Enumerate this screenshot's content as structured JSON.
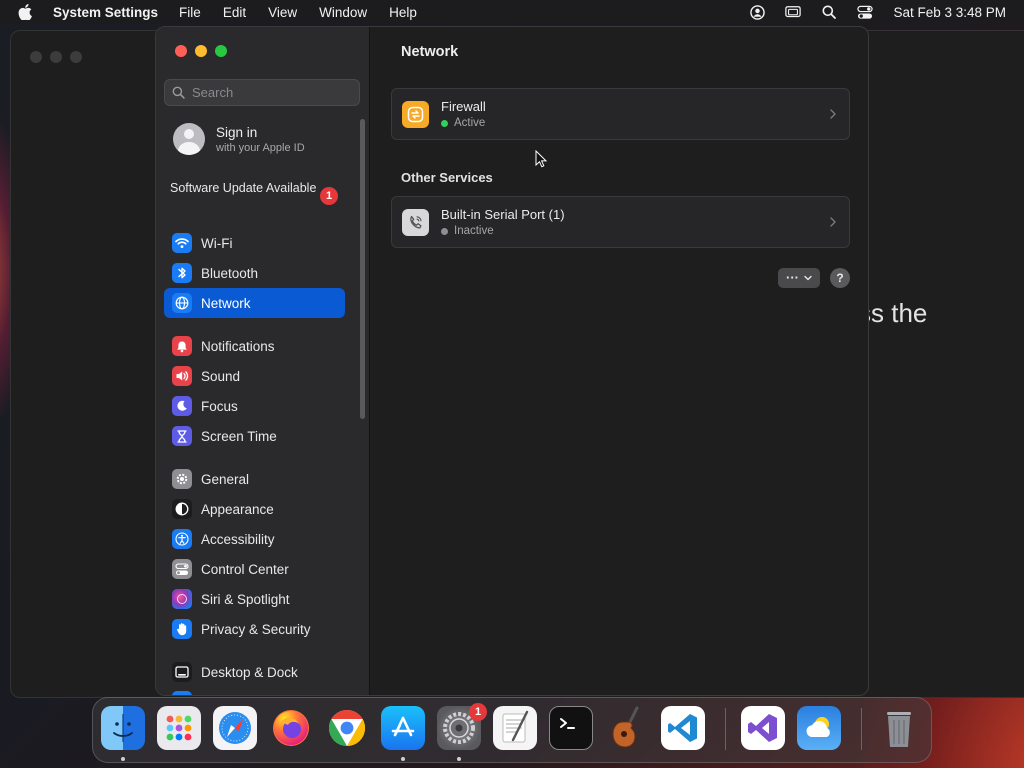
{
  "menubar": {
    "app_name": "System Settings",
    "items": [
      "File",
      "Edit",
      "View",
      "Window",
      "Help"
    ],
    "clock": "Sat Feb 3  3:48 PM"
  },
  "background_window": {
    "visible_text": "ss the"
  },
  "sidebar": {
    "search_placeholder": "Search",
    "sign_in": {
      "title": "Sign in",
      "subtitle": "with your Apple ID"
    },
    "update": {
      "label": "Software Update Available",
      "badge": "1"
    },
    "groups": [
      [
        {
          "label": "Wi-Fi",
          "icon": "wifi-icon",
          "color": "#1a7cf5"
        },
        {
          "label": "Bluetooth",
          "icon": "bluetooth-icon",
          "color": "#1a7cf5"
        },
        {
          "label": "Network",
          "icon": "globe-icon",
          "color": "#1a7cf5",
          "selected": true
        }
      ],
      [
        {
          "label": "Notifications",
          "icon": "bell-icon",
          "color": "#e8424b"
        },
        {
          "label": "Sound",
          "icon": "speaker-icon",
          "color": "#e8424b"
        },
        {
          "label": "Focus",
          "icon": "moon-icon",
          "color": "#5e5ce6"
        },
        {
          "label": "Screen Time",
          "icon": "hourglass-icon",
          "color": "#5e5ce6"
        }
      ],
      [
        {
          "label": "General",
          "icon": "gear-icon",
          "color": "#8e8e93"
        },
        {
          "label": "Appearance",
          "icon": "appearance-icon",
          "color": "#1c1c1e"
        },
        {
          "label": "Accessibility",
          "icon": "accessibility-icon",
          "color": "#1a7cf5"
        },
        {
          "label": "Control Center",
          "icon": "control-center-icon",
          "color": "#8e8e93"
        },
        {
          "label": "Siri & Spotlight",
          "icon": "siri-icon",
          "color": "#8a3ab9"
        },
        {
          "label": "Privacy & Security",
          "icon": "hand-icon",
          "color": "#1a7cf5"
        }
      ],
      [
        {
          "label": "Desktop & Dock",
          "icon": "desktop-icon",
          "color": "#1c1c1e"
        }
      ]
    ]
  },
  "content": {
    "title": "Network",
    "firewall": {
      "title": "Firewall",
      "status": "Active",
      "status_color": "#30d158"
    },
    "other_services_title": "Other Services",
    "serial_port": {
      "title": "Built-in Serial Port (1)",
      "status": "Inactive",
      "status_color": "#8e8e93"
    },
    "more_label": "···",
    "help_label": "?"
  },
  "dock": {
    "apps": [
      {
        "name": "Finder",
        "running": true
      },
      {
        "name": "Launchpad",
        "running": false
      },
      {
        "name": "Safari",
        "running": false
      },
      {
        "name": "Firefox",
        "running": false
      },
      {
        "name": "Chrome",
        "running": false
      },
      {
        "name": "App Store",
        "running": true
      },
      {
        "name": "System Settings",
        "running": true,
        "badge": "1"
      },
      {
        "name": "TextEdit",
        "running": false
      },
      {
        "name": "Terminal",
        "running": false
      },
      {
        "name": "GarageBand",
        "running": false
      },
      {
        "name": "Visual Studio Code",
        "running": false
      },
      {
        "name": "Visual Studio",
        "running": false
      },
      {
        "name": "Weather",
        "running": false
      },
      {
        "name": "Trash",
        "running": false
      }
    ]
  }
}
